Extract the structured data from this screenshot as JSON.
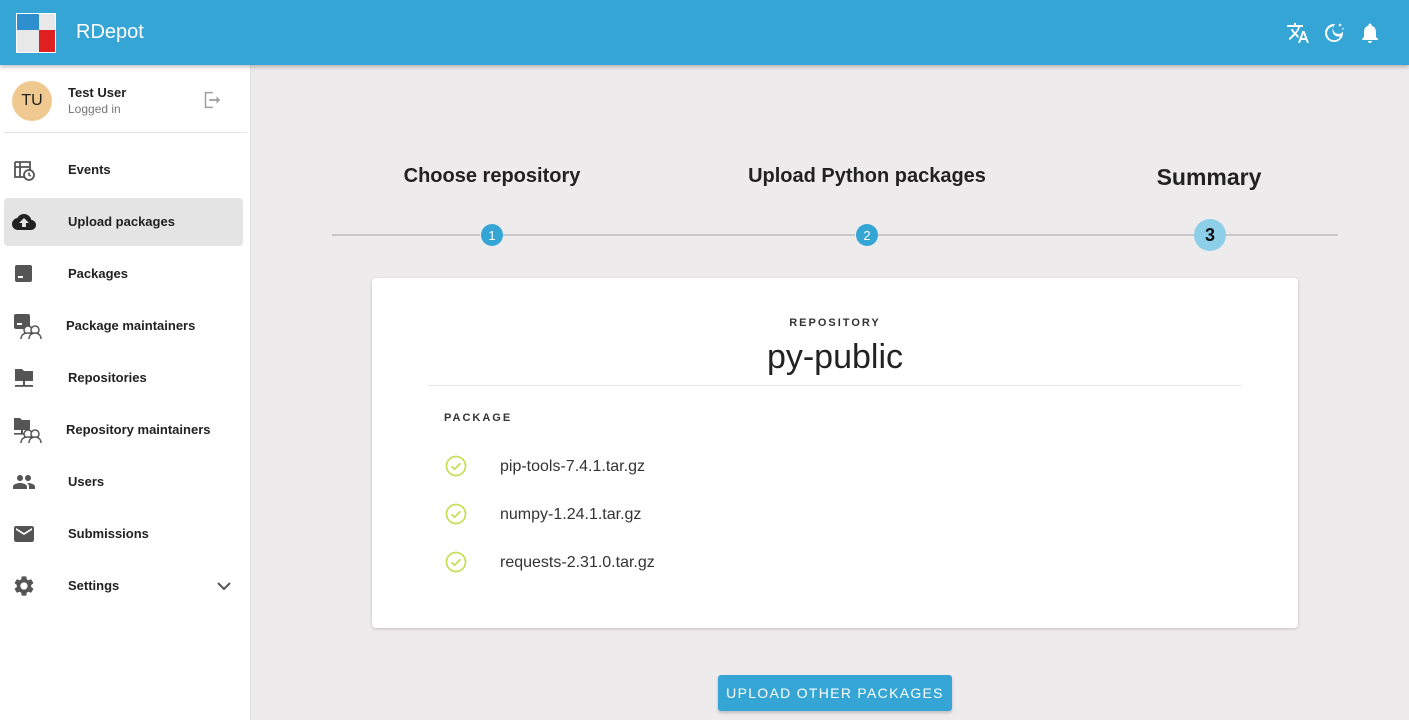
{
  "app": {
    "title": "RDepot",
    "accent": "#35a5d5"
  },
  "header": {
    "icons": [
      "translate-icon",
      "dark-mode-icon",
      "notifications-icon"
    ]
  },
  "user": {
    "initials": "TU",
    "name": "Test User",
    "status": "Logged in"
  },
  "sidebar": {
    "items": [
      {
        "label": "Events",
        "icon": "events-icon"
      },
      {
        "label": "Upload packages",
        "icon": "cloud-upload-icon",
        "active": true
      },
      {
        "label": "Packages",
        "icon": "package-icon"
      },
      {
        "label": "Package maintainers",
        "icon": "package-maintainers-icon"
      },
      {
        "label": "Repositories",
        "icon": "repository-icon"
      },
      {
        "label": "Repository maintainers",
        "icon": "repository-maintainers-icon"
      },
      {
        "label": "Users",
        "icon": "users-icon"
      },
      {
        "label": "Submissions",
        "icon": "mail-icon"
      },
      {
        "label": "Settings",
        "icon": "gear-icon",
        "expandable": true
      }
    ]
  },
  "stepper": {
    "steps": [
      {
        "number": "1",
        "title": "Choose repository",
        "state": "done"
      },
      {
        "number": "2",
        "title": "Upload Python packages",
        "state": "done"
      },
      {
        "number": "3",
        "title": "Summary",
        "state": "current"
      }
    ]
  },
  "summary": {
    "repository_label": "REPOSITORY",
    "repository_name": "py-public",
    "package_label": "PACKAGE",
    "packages": [
      {
        "name": "pip-tools-7.4.1.tar.gz",
        "status": "success"
      },
      {
        "name": "numpy-1.24.1.tar.gz",
        "status": "success"
      },
      {
        "name": "requests-2.31.0.tar.gz",
        "status": "success"
      }
    ],
    "success_color": "#c6df5a"
  },
  "actions": {
    "upload_other": "UPLOAD OTHER PACKAGES"
  }
}
